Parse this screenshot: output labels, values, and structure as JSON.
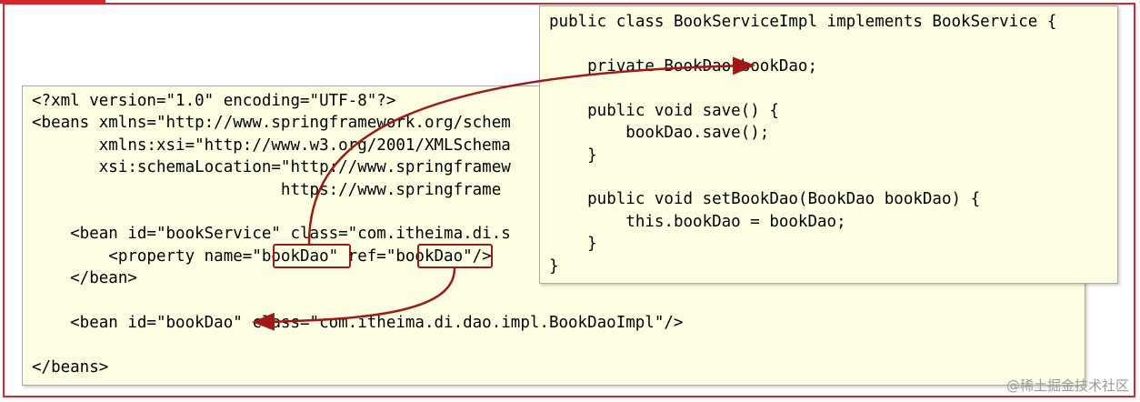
{
  "xml_lines": [
    "<?xml version=\"1.0\" encoding=\"UTF-8\"?>",
    "<beans xmlns=\"http://www.springframework.org/schem",
    "       xmlns:xsi=\"http://www.w3.org/2001/XMLSchema",
    "       xsi:schemaLocation=\"http://www.springframew",
    "                          https://www.springframe",
    "",
    "    <bean id=\"bookService\" class=\"com.itheima.di.s",
    "        <property name=\"bookDao\" ref=\"bookDao\"/>",
    "    </bean>",
    "",
    "    <bean id=\"bookDao\" class=\"com.itheima.di.dao.impl.BookDaoImpl\"/>",
    "",
    "</beans>"
  ],
  "java_lines": [
    "public class BookServiceImpl implements BookService {",
    "",
    "    private BookDao bookDao;",
    "",
    "    public void save() {",
    "        bookDao.save();",
    "    }",
    "",
    "    public void setBookDao(BookDao bookDao) {",
    "        this.bookDao = bookDao;",
    "    }",
    "}"
  ],
  "highlights": [
    "bookDao",
    "bookDao"
  ],
  "colors": {
    "frame": "#d9262c",
    "arrow": "#a01818",
    "panel_bg": "#fefee2"
  },
  "watermark": "@稀土掘金技术社区"
}
